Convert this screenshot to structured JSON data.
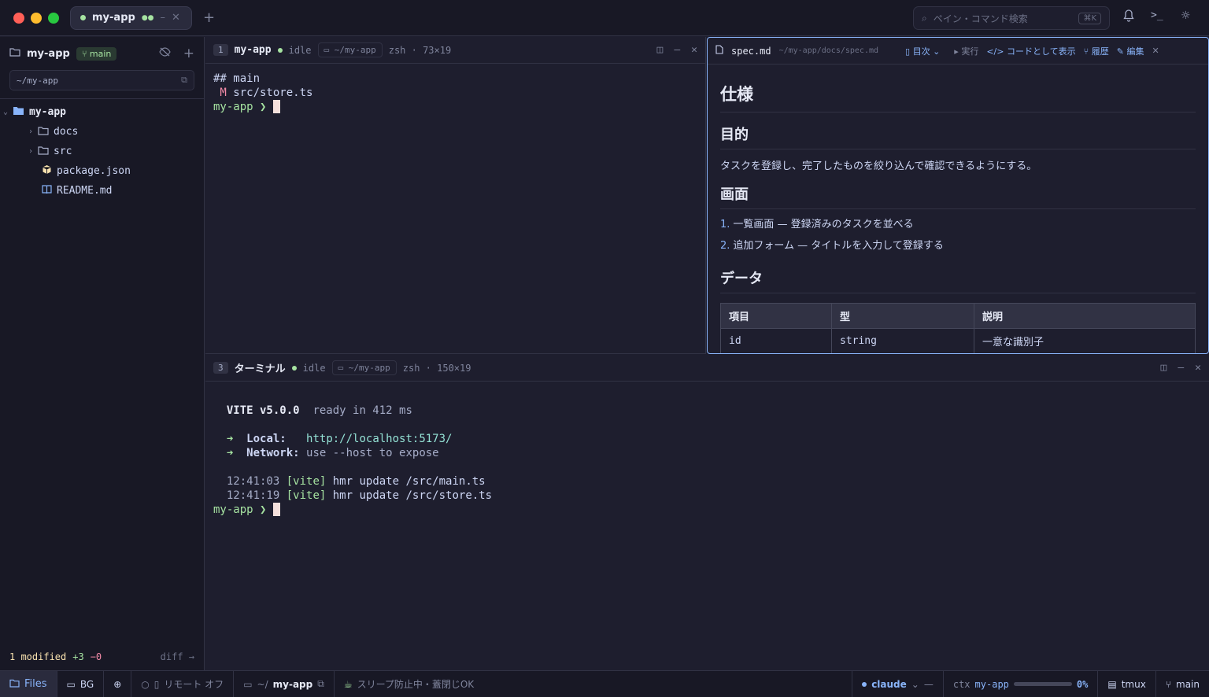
{
  "titlebar": {
    "tab_label": "my-app",
    "search_placeholder": "ペイン・コマンド検索",
    "search_shortcut": "⌘K"
  },
  "sidebar": {
    "project": "my-app",
    "branch": "main",
    "path": "~/my-app",
    "tree": [
      {
        "label": "my-app",
        "type": "root-folder"
      },
      {
        "label": "docs",
        "type": "folder"
      },
      {
        "label": "src",
        "type": "folder"
      },
      {
        "label": "package.json",
        "type": "package"
      },
      {
        "label": "README.md",
        "type": "book"
      }
    ],
    "footer": {
      "modified": "1 modified",
      "added": "+3",
      "removed": "−0",
      "diff": "diff →"
    }
  },
  "pane1": {
    "num": "1",
    "name": "my-app",
    "state": "idle",
    "path": "~/my-app",
    "shell": "zsh · 73×19",
    "lines": [
      "## main",
      " M src/store.ts"
    ],
    "prompt": "my-app ❯ "
  },
  "pane3": {
    "num": "3",
    "name": "ターミナル",
    "state": "idle",
    "path": "~/my-app",
    "shell": "zsh · 150×19",
    "vite": "VITE v5.0.0",
    "ready": "ready in 412 ms",
    "local_label": "Local:",
    "local_url": "http://localhost:5173/",
    "network_label": "Network:",
    "network_text": "use --host to expose",
    "log": [
      {
        "time": "12:41:03",
        "tag": "[vite]",
        "msg": "hmr update /src/main.ts"
      },
      {
        "time": "12:41:19",
        "tag": "[vite]",
        "msg": "hmr update /src/store.ts"
      }
    ],
    "prompt": "my-app ❯ "
  },
  "md": {
    "file": "spec.md",
    "path": "~/my-app/docs/spec.md",
    "toc": "目次",
    "run": "実行",
    "code_view": "</> コードとして表示",
    "history": "履歴",
    "edit": "編集",
    "h1": "仕様",
    "purpose_h": "目的",
    "purpose_p": "タスクを登録し、完了したものを絞り込んで確認できるようにする。",
    "screen_h": "画面",
    "screen_items": [
      "一覧画面 — 登録済みのタスクを並べる",
      "追加フォーム — タイトルを入力して登録する"
    ],
    "data_h": "データ",
    "table_headers": [
      "項目",
      "型",
      "説明"
    ],
    "table_rows": [
      [
        "id",
        "string",
        "一意な識別子"
      ]
    ]
  },
  "statusbar": {
    "files": "Files",
    "bg": "BG",
    "remote": "リモート オフ",
    "path": "~/",
    "app": "my-app",
    "sleep": "スリープ防止中・蓋閉じOK",
    "claude": "claude",
    "dash": "—",
    "ctx_label": "ctx",
    "ctx_app": "my-app",
    "ctx_pct": "0%",
    "ctx_value": 0,
    "tmux": "tmux",
    "branch": "main"
  },
  "colors": {
    "accent": "#89b4fa",
    "green": "#a6e3a1",
    "red": "#f38ba8",
    "yellow": "#f9e2af"
  }
}
